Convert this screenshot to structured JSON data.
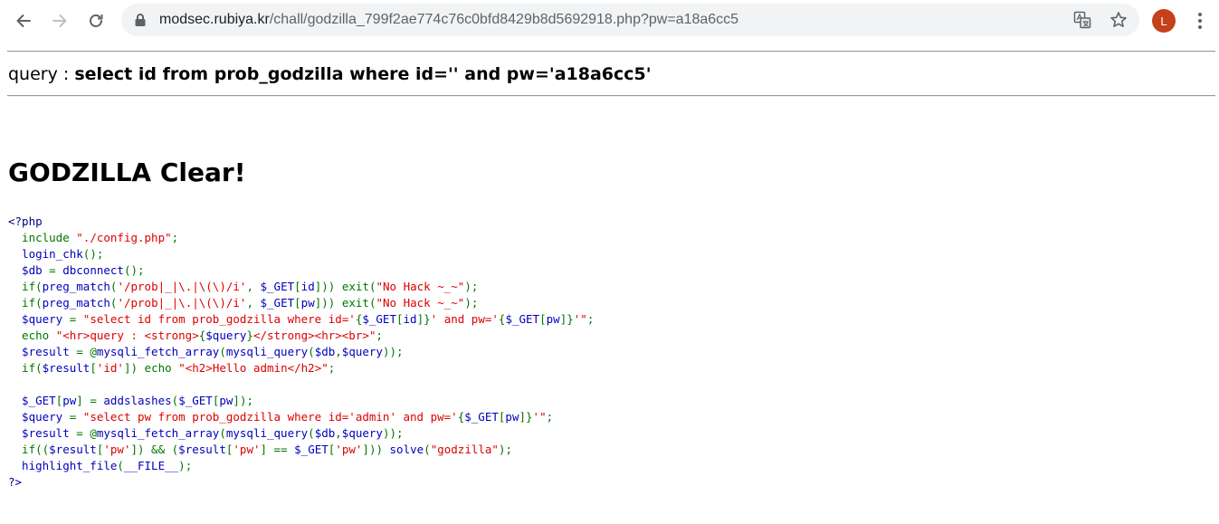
{
  "browser": {
    "url_host": "modsec.rubiya.kr",
    "url_path": "/chall/godzilla_799f2ae774c76c0bfd8429b8d5692918.php?pw=a18a6cc5",
    "avatar_letter": "L",
    "icons": [
      "back-icon",
      "forward-icon",
      "reload-icon",
      "lock-icon",
      "translate-icon",
      "star-icon",
      "menu-icon"
    ],
    "colors": {
      "omnibox_bg": "#f1f3f4",
      "avatar_bg": "#c5411a"
    }
  },
  "page": {
    "query_label": "query : ",
    "query_text": "select id from prob_godzilla where id='' and pw='a18a6cc5'",
    "heading": "GODZILLA Clear!",
    "code_lines": [
      [
        {
          "t": "<?php",
          "c": "k"
        }
      ],
      [
        {
          "t": "  include ",
          "c": "g"
        },
        {
          "t": "\"./config.php\"",
          "c": "r"
        },
        {
          "t": ";",
          "c": "g"
        }
      ],
      [
        {
          "t": "  login_chk",
          "c": "b"
        },
        {
          "t": "();",
          "c": "g"
        }
      ],
      [
        {
          "t": "  $db ",
          "c": "b"
        },
        {
          "t": "= ",
          "c": "g"
        },
        {
          "t": "dbconnect",
          "c": "b"
        },
        {
          "t": "();",
          "c": "g"
        }
      ],
      [
        {
          "t": "  if(",
          "c": "g"
        },
        {
          "t": "preg_match",
          "c": "b"
        },
        {
          "t": "(",
          "c": "g"
        },
        {
          "t": "'/prob|_|\\.|\\(\\)/i'",
          "c": "r"
        },
        {
          "t": ", ",
          "c": "g"
        },
        {
          "t": "$_GET",
          "c": "b"
        },
        {
          "t": "[",
          "c": "g"
        },
        {
          "t": "id",
          "c": "b"
        },
        {
          "t": "])) exit(",
          "c": "g"
        },
        {
          "t": "\"No Hack ~_~\"",
          "c": "r"
        },
        {
          "t": ");",
          "c": "g"
        }
      ],
      [
        {
          "t": "  if(",
          "c": "g"
        },
        {
          "t": "preg_match",
          "c": "b"
        },
        {
          "t": "(",
          "c": "g"
        },
        {
          "t": "'/prob|_|\\.|\\(\\)/i'",
          "c": "r"
        },
        {
          "t": ", ",
          "c": "g"
        },
        {
          "t": "$_GET",
          "c": "b"
        },
        {
          "t": "[",
          "c": "g"
        },
        {
          "t": "pw",
          "c": "b"
        },
        {
          "t": "])) exit(",
          "c": "g"
        },
        {
          "t": "\"No Hack ~_~\"",
          "c": "r"
        },
        {
          "t": ");",
          "c": "g"
        }
      ],
      [
        {
          "t": "  $query ",
          "c": "b"
        },
        {
          "t": "= ",
          "c": "g"
        },
        {
          "t": "\"select id from prob_godzilla where id='",
          "c": "r"
        },
        {
          "t": "{",
          "c": "g"
        },
        {
          "t": "$_GET",
          "c": "b"
        },
        {
          "t": "[",
          "c": "g"
        },
        {
          "t": "id",
          "c": "b"
        },
        {
          "t": "]}",
          "c": "g"
        },
        {
          "t": "' and pw='",
          "c": "r"
        },
        {
          "t": "{",
          "c": "g"
        },
        {
          "t": "$_GET",
          "c": "b"
        },
        {
          "t": "[",
          "c": "g"
        },
        {
          "t": "pw",
          "c": "b"
        },
        {
          "t": "]}",
          "c": "g"
        },
        {
          "t": "'\"",
          "c": "r"
        },
        {
          "t": ";",
          "c": "g"
        }
      ],
      [
        {
          "t": "  echo ",
          "c": "g"
        },
        {
          "t": "\"<hr>query : <strong>",
          "c": "r"
        },
        {
          "t": "{",
          "c": "g"
        },
        {
          "t": "$query",
          "c": "b"
        },
        {
          "t": "}",
          "c": "g"
        },
        {
          "t": "</strong><hr><br>\"",
          "c": "r"
        },
        {
          "t": ";",
          "c": "g"
        }
      ],
      [
        {
          "t": "  $result ",
          "c": "b"
        },
        {
          "t": "= @",
          "c": "g"
        },
        {
          "t": "mysqli_fetch_array",
          "c": "b"
        },
        {
          "t": "(",
          "c": "g"
        },
        {
          "t": "mysqli_query",
          "c": "b"
        },
        {
          "t": "(",
          "c": "g"
        },
        {
          "t": "$db",
          "c": "b"
        },
        {
          "t": ",",
          "c": "g"
        },
        {
          "t": "$query",
          "c": "b"
        },
        {
          "t": "));",
          "c": "g"
        }
      ],
      [
        {
          "t": "  if(",
          "c": "g"
        },
        {
          "t": "$result",
          "c": "b"
        },
        {
          "t": "[",
          "c": "g"
        },
        {
          "t": "'id'",
          "c": "r"
        },
        {
          "t": "]) echo ",
          "c": "g"
        },
        {
          "t": "\"<h2>Hello admin</h2>\"",
          "c": "r"
        },
        {
          "t": ";",
          "c": "g"
        }
      ],
      [
        {
          "t": "  ",
          "c": "g"
        }
      ],
      [
        {
          "t": "  $_GET",
          "c": "b"
        },
        {
          "t": "[",
          "c": "g"
        },
        {
          "t": "pw",
          "c": "b"
        },
        {
          "t": "] = ",
          "c": "g"
        },
        {
          "t": "addslashes",
          "c": "b"
        },
        {
          "t": "(",
          "c": "g"
        },
        {
          "t": "$_GET",
          "c": "b"
        },
        {
          "t": "[",
          "c": "g"
        },
        {
          "t": "pw",
          "c": "b"
        },
        {
          "t": "]);",
          "c": "g"
        }
      ],
      [
        {
          "t": "  $query ",
          "c": "b"
        },
        {
          "t": "= ",
          "c": "g"
        },
        {
          "t": "\"select pw from prob_godzilla where id='admin' and pw='",
          "c": "r"
        },
        {
          "t": "{",
          "c": "g"
        },
        {
          "t": "$_GET",
          "c": "b"
        },
        {
          "t": "[",
          "c": "g"
        },
        {
          "t": "pw",
          "c": "b"
        },
        {
          "t": "]}",
          "c": "g"
        },
        {
          "t": "'\"",
          "c": "r"
        },
        {
          "t": ";",
          "c": "g"
        }
      ],
      [
        {
          "t": "  $result ",
          "c": "b"
        },
        {
          "t": "= @",
          "c": "g"
        },
        {
          "t": "mysqli_fetch_array",
          "c": "b"
        },
        {
          "t": "(",
          "c": "g"
        },
        {
          "t": "mysqli_query",
          "c": "b"
        },
        {
          "t": "(",
          "c": "g"
        },
        {
          "t": "$db",
          "c": "b"
        },
        {
          "t": ",",
          "c": "g"
        },
        {
          "t": "$query",
          "c": "b"
        },
        {
          "t": "));",
          "c": "g"
        }
      ],
      [
        {
          "t": "  if((",
          "c": "g"
        },
        {
          "t": "$result",
          "c": "b"
        },
        {
          "t": "[",
          "c": "g"
        },
        {
          "t": "'pw'",
          "c": "r"
        },
        {
          "t": "]) && (",
          "c": "g"
        },
        {
          "t": "$result",
          "c": "b"
        },
        {
          "t": "[",
          "c": "g"
        },
        {
          "t": "'pw'",
          "c": "r"
        },
        {
          "t": "] == ",
          "c": "g"
        },
        {
          "t": "$_GET",
          "c": "b"
        },
        {
          "t": "[",
          "c": "g"
        },
        {
          "t": "'pw'",
          "c": "r"
        },
        {
          "t": "])) ",
          "c": "g"
        },
        {
          "t": "solve",
          "c": "b"
        },
        {
          "t": "(",
          "c": "g"
        },
        {
          "t": "\"godzilla\"",
          "c": "r"
        },
        {
          "t": ");",
          "c": "g"
        }
      ],
      [
        {
          "t": "  highlight_file",
          "c": "b"
        },
        {
          "t": "(",
          "c": "g"
        },
        {
          "t": "__FILE__",
          "c": "b"
        },
        {
          "t": ");",
          "c": "g"
        }
      ],
      [
        {
          "t": "?>",
          "c": "k"
        }
      ]
    ]
  }
}
